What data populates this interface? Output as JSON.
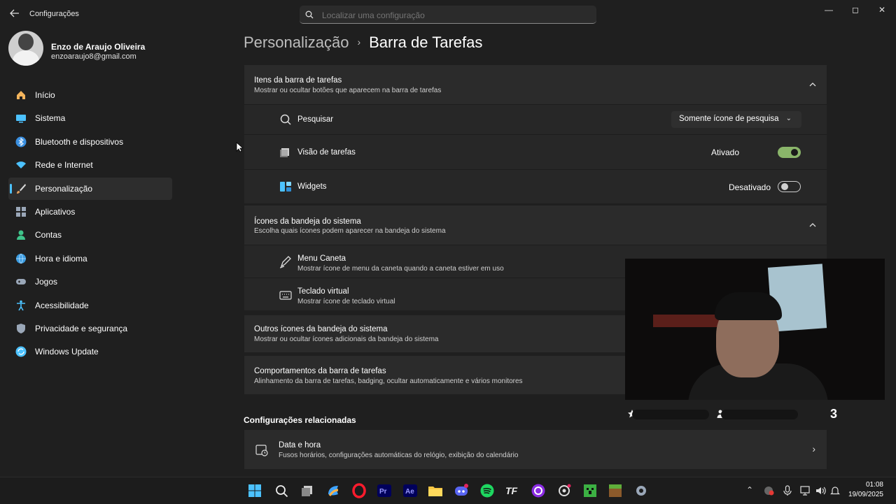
{
  "window": {
    "title": "Configurações",
    "min_glyph": "—",
    "max_glyph": "◻",
    "close_glyph": "✕"
  },
  "search": {
    "placeholder": "Localizar uma configuração"
  },
  "profile": {
    "name": "Enzo de Araujo Oliveira",
    "email": "enzoaraujo8@gmail.com"
  },
  "sidebar": {
    "items": [
      {
        "label": "Início",
        "icon": "home-icon",
        "color": "#f3b45c"
      },
      {
        "label": "Sistema",
        "icon": "monitor-icon",
        "color": "#4cc2ff"
      },
      {
        "label": "Bluetooth e dispositivos",
        "icon": "bluetooth-icon",
        "color": "#3a8fe0"
      },
      {
        "label": "Rede e Internet",
        "icon": "wifi-icon",
        "color": "#4cc2ff"
      },
      {
        "label": "Personalização",
        "icon": "brush-icon",
        "color": "#e0a060"
      },
      {
        "label": "Aplicativos",
        "icon": "apps-icon",
        "color": "#9aa7b8"
      },
      {
        "label": "Contas",
        "icon": "person-icon",
        "color": "#3fc48b"
      },
      {
        "label": "Hora e idioma",
        "icon": "globe-icon",
        "color": "#3a9be0"
      },
      {
        "label": "Jogos",
        "icon": "gamepad-icon",
        "color": "#9aa7b8"
      },
      {
        "label": "Acessibilidade",
        "icon": "accessibility-icon",
        "color": "#4cc2ff"
      },
      {
        "label": "Privacidade e segurança",
        "icon": "shield-icon",
        "color": "#9aa7b8"
      },
      {
        "label": "Windows Update",
        "icon": "update-icon",
        "color": "#4cc2ff"
      }
    ],
    "active_index": 4
  },
  "breadcrumb": {
    "parent": "Personalização",
    "separator": "›",
    "current": "Barra de Tarefas"
  },
  "taskbar_items": {
    "title": "Itens da barra de tarefas",
    "subtitle": "Mostrar ou ocultar botões que aparecem na barra de tarefas",
    "rows": [
      {
        "label": "Pesquisar",
        "control": "dropdown",
        "value": "Somente ícone de pesquisa"
      },
      {
        "label": "Visão de tarefas",
        "control": "toggle",
        "state_label": "Ativado",
        "on": true
      },
      {
        "label": "Widgets",
        "control": "toggle",
        "state_label": "Desativado",
        "on": false
      }
    ]
  },
  "tray_icons": {
    "title": "Ícones da bandeja do sistema",
    "subtitle": "Escolha quais ícones podem aparecer na bandeja do sistema",
    "rows": [
      {
        "label": "Menu Caneta",
        "sub": "Mostrar ícone de menu da caneta quando a caneta estiver em uso"
      },
      {
        "label": "Teclado virtual",
        "sub": "Mostrar ícone de teclado virtual"
      }
    ]
  },
  "other_tray": {
    "title": "Outros ícones da bandeja do sistema",
    "subtitle": "Mostrar ou ocultar ícones adicionais da bandeja do sistema"
  },
  "behaviors": {
    "title": "Comportamentos da barra de tarefas",
    "subtitle": "Alinhamento da barra de tarefas, badging, ocultar automaticamente e vários monitores"
  },
  "related": {
    "heading": "Configurações relacionadas",
    "items": [
      {
        "title": "Data e hora",
        "subtitle": "Fusos horários, configurações automáticas do relógio, exibição do calendário"
      }
    ]
  },
  "overlay": {
    "number": "3"
  },
  "clock": {
    "time": "01:08",
    "date": "19/09/2025"
  },
  "colors": {
    "accent": "#4cc2ff",
    "toggle_on": "#8ab56a"
  }
}
